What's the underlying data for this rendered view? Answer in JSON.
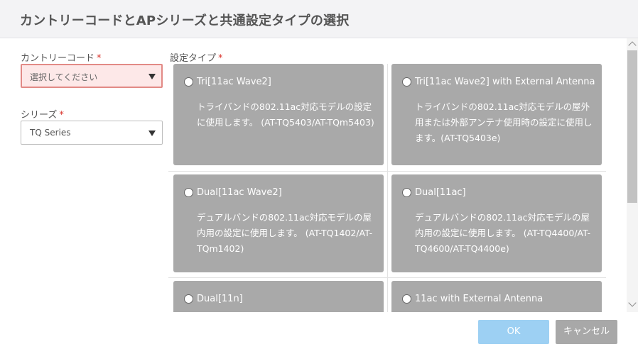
{
  "dialog": {
    "title": "カントリーコードとAPシリーズと共通設定タイプの選択"
  },
  "country_code": {
    "label": "カントリーコード",
    "required_mark": "*",
    "value": "選択してください"
  },
  "series": {
    "label": "シリーズ",
    "required_mark": "*",
    "value": "TQ Series"
  },
  "setting_type": {
    "label": "設定タイプ",
    "required_mark": "*",
    "options": [
      {
        "title": "Tri[11ac Wave2]",
        "description": "トライバンドの802.11ac対応モデルの設定に使用します。 (AT-TQ5403/AT-TQm5403)"
      },
      {
        "title": "Tri[11ac Wave2] with External Antenna",
        "description": "トライバンドの802.11ac対応モデルの屋外用または外部アンテナ使用時の設定に使用します。(AT-TQ5403e)"
      },
      {
        "title": "Dual[11ac Wave2]",
        "description": "デュアルバンドの802.11ac対応モデルの屋内用の設定に使用します。 (AT-TQ1402/AT-TQm1402)"
      },
      {
        "title": "Dual[11ac]",
        "description": "デュアルバンドの802.11ac対応モデルの屋内用の設定に使用します。 (AT-TQ4400/AT-TQ4600/AT-TQ4400e)"
      },
      {
        "title": "Dual[11n]",
        "description": ""
      },
      {
        "title": "11ac with External Antenna",
        "description": ""
      }
    ]
  },
  "buttons": {
    "ok_label": "OK",
    "cancel_label": "キャンセル"
  },
  "colors": {
    "ok_button": "#9dd0f3",
    "cancel_button": "#a8a8a8",
    "card_background": "#a9a9a9",
    "required_mark": "#d9322b",
    "invalid_field_background": "#fde8e8"
  }
}
